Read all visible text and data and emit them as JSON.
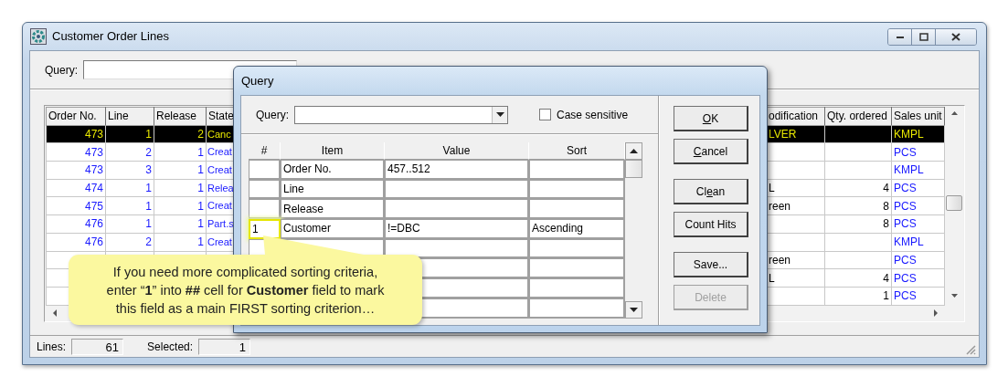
{
  "window": {
    "title": "Customer Order Lines"
  },
  "query": {
    "label": "Query:"
  },
  "table": {
    "columns": [
      "Order No.",
      "Line",
      "Release",
      "State",
      "odification",
      "Qty. ordered",
      "Sales unit"
    ],
    "rows": [
      {
        "selected": true,
        "order_no": "473",
        "line": "1",
        "release": "2",
        "state": "Canc",
        "modification": "LVER",
        "sales_unit": "KMPL"
      },
      {
        "selected": false,
        "order_no": "473",
        "line": "2",
        "release": "1",
        "state": "Creat",
        "sales_unit": "PCS"
      },
      {
        "selected": false,
        "order_no": "473",
        "line": "3",
        "release": "1",
        "state": "Creat",
        "sales_unit": "KMPL"
      },
      {
        "selected": false,
        "order_no": "474",
        "line": "1",
        "release": "1",
        "state": "Relea",
        "modification": "L",
        "qty_ordered": "4",
        "sales_unit": "PCS"
      },
      {
        "selected": false,
        "order_no": "475",
        "line": "1",
        "release": "1",
        "state": "Creat",
        "modification": "reen",
        "qty_ordered": "8",
        "sales_unit": "PCS"
      },
      {
        "selected": false,
        "order_no": "476",
        "line": "1",
        "release": "1",
        "state": "Part.s",
        "qty_ordered": "8",
        "sales_unit": "PCS"
      },
      {
        "selected": false,
        "order_no": "476",
        "line": "2",
        "release": "1",
        "state": "Creat",
        "sales_unit": "KMPL"
      },
      {
        "selected": false,
        "modification": "reen",
        "sales_unit": "PCS"
      },
      {
        "selected": false,
        "modification": "L",
        "qty_ordered": "4",
        "sales_unit": "PCS"
      },
      {
        "selected": false,
        "qty_ordered": "1",
        "sales_unit": "PCS"
      }
    ]
  },
  "status_bar": {
    "lines_label": "Lines:",
    "lines": "61",
    "selected_label": "Selected:",
    "selected": "1"
  },
  "dialog": {
    "title": "Query",
    "query_label": "Query:",
    "case_sensitive": {
      "label": "Case sensitive",
      "checked": false
    },
    "columns": [
      "#",
      "Item",
      "Value",
      "Sort"
    ],
    "rows": [
      {
        "highlighted": false,
        "item": "Order No.",
        "value": "457..512"
      },
      {
        "highlighted": false,
        "item": "Line"
      },
      {
        "highlighted": false,
        "item": "Release"
      },
      {
        "highlighted": true,
        "number": "1",
        "item": "Customer",
        "value": "!=DBC",
        "sort": "Ascending"
      },
      {},
      {},
      {},
      {}
    ],
    "button_groups": [
      [
        {
          "label": [
            {
              "text": "O",
              "underlined": true
            },
            {
              "text": "K",
              "underlined": false
            }
          ],
          "disabled": false
        },
        {
          "label": [
            {
              "text": "C",
              "underlined": true
            },
            {
              "text": "ancel",
              "underlined": false
            }
          ],
          "disabled": false
        }
      ],
      [
        {
          "label": [
            {
              "text": "Cl",
              "underlined": false
            },
            {
              "text": "e",
              "underlined": true
            },
            {
              "text": "an",
              "underlined": false
            }
          ],
          "disabled": false
        },
        {
          "label": [
            {
              "text": "Count Hits",
              "underlined": false
            }
          ],
          "disabled": false
        }
      ],
      [
        {
          "label": [
            {
              "text": "Save...",
              "underlined": false
            }
          ],
          "disabled": false
        },
        {
          "label": [
            {
              "text": "Delete",
              "underlined": false
            }
          ],
          "disabled": true
        }
      ]
    ]
  },
  "callout": {
    "lines": [
      "If you need more complicated sorting criteria,",
      "enter “**1**” into **##** cell for **Customer** field to mark",
      "this field as a main FIRST sorting criterion…"
    ]
  }
}
